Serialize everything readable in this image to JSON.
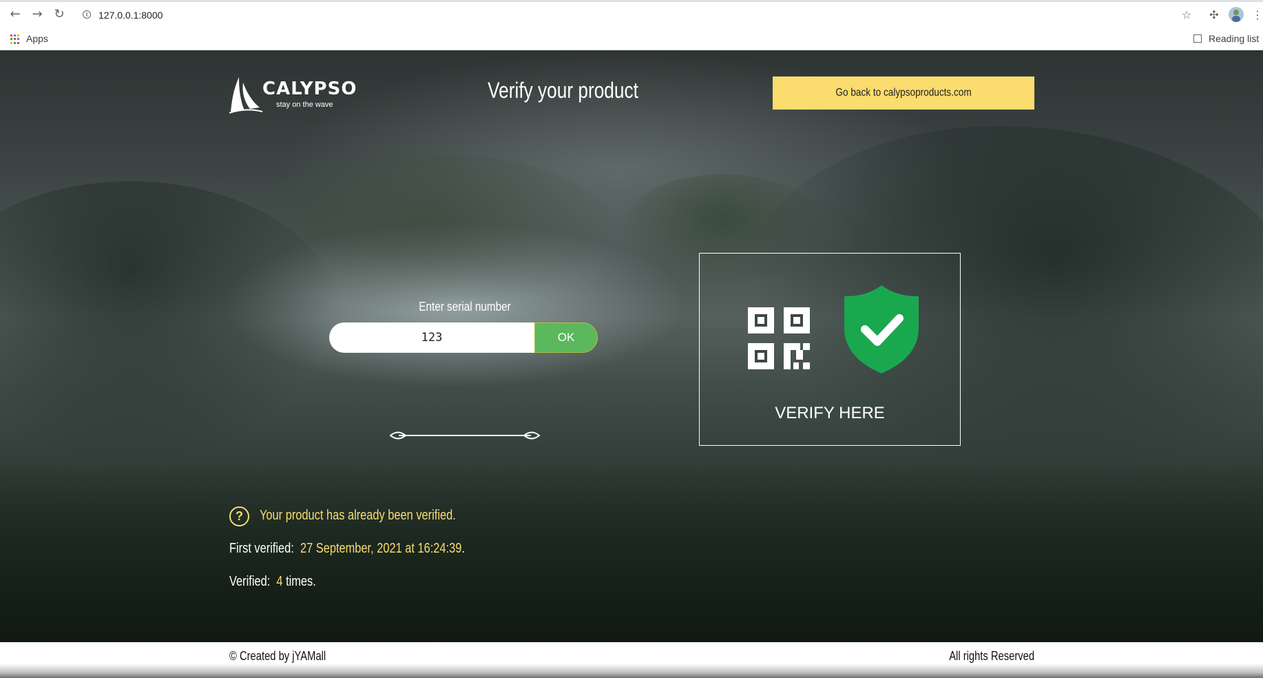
{
  "browser": {
    "url": "127.0.0.1:8000",
    "bookmarks_apps_label": "Apps",
    "reading_list_label": "Reading list",
    "icons": [
      "back-arrow-icon",
      "forward-arrow-icon",
      "reload-icon",
      "info-icon",
      "star-icon",
      "extensions-puzzle-icon",
      "profile-avatar",
      "kebab-menu-icon",
      "apps-grid-icon",
      "reading-list-icon"
    ]
  },
  "header": {
    "brand_name": "CALYPSO",
    "brand_tagline": "stay on the wave",
    "title": "Verify your product",
    "back_button_label": "Go back to calypsoproducts.com"
  },
  "serial_form": {
    "label": "Enter serial number",
    "value": "123",
    "submit_label": "OK"
  },
  "verify_card": {
    "label": "VERIFY HERE",
    "icons": [
      "qr-code-icon",
      "shield-check-icon"
    ]
  },
  "status": {
    "message": "Your product has already been verified.",
    "first_verified_label": "First verified:",
    "first_verified_value": "27 September, 2021 at 16:24:39",
    "first_verified_suffix": ".",
    "verified_label": "Verified:",
    "verified_count": "4",
    "verified_suffix": "times."
  },
  "footer": {
    "credit": "© Created by jYAMall",
    "rights": "All rights Reserved"
  },
  "colors": {
    "accent_yellow": "#fbdc6e",
    "ok_green": "#5cb85c",
    "shield_green": "#1aa84f",
    "text_white": "#ffffff"
  }
}
